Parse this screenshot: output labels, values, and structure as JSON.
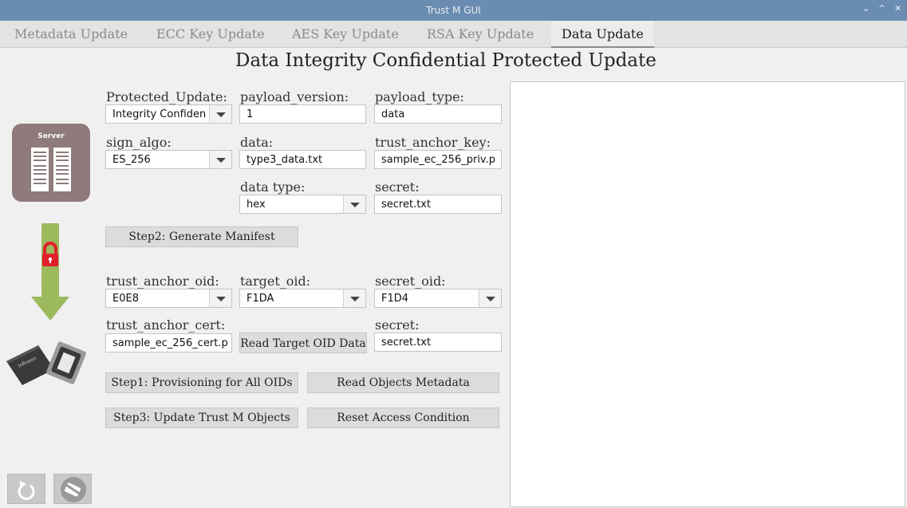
{
  "window": {
    "title": "Trust M GUI",
    "controls": [
      "⌄",
      "^",
      "✕"
    ]
  },
  "tabs": [
    "Metadata Update",
    "ECC Key Update",
    "AES Key Update",
    "RSA Key Update",
    "Data Update"
  ],
  "active_tab": "Data Update",
  "heading": "Data Integrity Confidential Protected Update",
  "server_label": "Server",
  "chip_label": "Infineon",
  "form": {
    "protected_update_label": "Protected_Update:",
    "protected_update_value": "Integrity Confiden",
    "payload_version_label": "payload_version:",
    "payload_version_value": "1",
    "payload_type_label": "payload_type:",
    "payload_type_value": "data",
    "sign_algo_label": "sign_algo:",
    "sign_algo_value": "ES_256",
    "data_label": "data:",
    "data_value": "type3_data.txt",
    "trust_anchor_key_label": "trust_anchor_key:",
    "trust_anchor_key_value": "sample_ec_256_priv.p",
    "data_type_label": "data type:",
    "data_type_value": "hex",
    "secret_label": "secret:",
    "secret_value": "secret.txt",
    "trust_anchor_oid_label": "trust_anchor_oid:",
    "trust_anchor_oid_value": "E0E8",
    "target_oid_label": "target_oid:",
    "target_oid_value": "F1DA",
    "secret_oid_label": "secret_oid:",
    "secret_oid_value": "F1D4",
    "trust_anchor_cert_label": "trust_anchor_cert:",
    "trust_anchor_cert_value": "sample_ec_256_cert.p",
    "secret2_label": "secret:",
    "secret2_value": "secret.txt"
  },
  "buttons": {
    "generate_manifest": "Step2: Generate Manifest",
    "read_target_oid": "Read Target OID Data",
    "provisioning": "Step1: Provisioning for All OIDs",
    "read_metadata": "Read Objects Metadata",
    "update_objects": "Step3: Update Trust M Objects",
    "reset_access": "Reset Access Condition"
  },
  "colors": {
    "titlebar": "#6a8cb0",
    "server": "#8f7b7b",
    "arrow": "#9cb95e",
    "lock": "#e0202a"
  }
}
